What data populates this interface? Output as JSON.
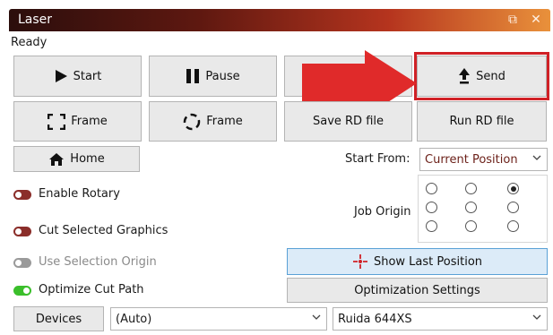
{
  "window": {
    "title": "Laser",
    "restore_icon": "restore-window-icon",
    "close_icon": "close-icon"
  },
  "status": "Ready",
  "buttons": {
    "start": "Start",
    "pause": "Pause",
    "send": "Send",
    "frame_rect": "Frame",
    "frame_circle": "Frame",
    "save_rd": "Save RD file",
    "run_rd": "Run RD file",
    "home": "Home",
    "show_last_position": "Show Last Position",
    "optimization_settings": "Optimization Settings",
    "devices": "Devices"
  },
  "start_from": {
    "label": "Start From:",
    "value": "Current Position"
  },
  "job_origin": {
    "label": "Job Origin",
    "selected_index": 2
  },
  "options": [
    {
      "label": "Enable Rotary",
      "state": "off",
      "enabled": true
    },
    {
      "label": "Cut Selected Graphics",
      "state": "off",
      "enabled": true
    },
    {
      "label": "Use Selection Origin",
      "state": "off",
      "enabled": false
    },
    {
      "label": "Optimize Cut Path",
      "state": "on",
      "enabled": true
    }
  ],
  "device_port": "(Auto)",
  "device_model": "Ruida 644XS",
  "colors": {
    "toggle_off": "#8b2e2a",
    "toggle_on": "#3bbf2b",
    "highlight_red": "#d02126",
    "arrow_red": "#e02a2a"
  }
}
